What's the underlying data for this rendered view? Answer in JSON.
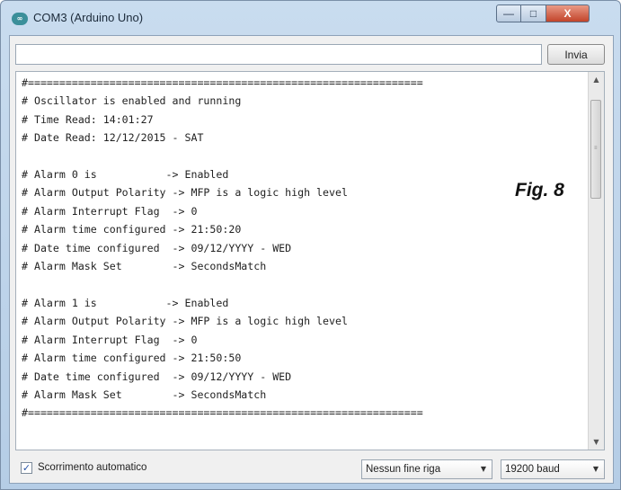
{
  "window": {
    "title": "COM3 (Arduino Uno)",
    "icon_text": "∞",
    "controls": {
      "minimize": "—",
      "maximize": "□",
      "close": "X"
    }
  },
  "send": {
    "input_value": "",
    "input_placeholder": "",
    "button_label": "Invia"
  },
  "serial_output": [
    "#===============================================================",
    "# Oscillator is enabled and running",
    "# Time Read: 14:01:27",
    "# Date Read: 12/12/2015 - SAT",
    "",
    "# Alarm 0 is           -> Enabled",
    "# Alarm Output Polarity -> MFP is a logic high level",
    "# Alarm Interrupt Flag  -> 0",
    "# Alarm time configured -> 21:50:20",
    "# Date time configured  -> 09/12/YYYY - WED",
    "# Alarm Mask Set        -> SecondsMatch",
    "",
    "# Alarm 1 is           -> Enabled",
    "# Alarm Output Polarity -> MFP is a logic high level",
    "# Alarm Interrupt Flag  -> 0",
    "# Alarm time configured -> 21:50:50",
    "# Date time configured  -> 09/12/YYYY - WED",
    "# Alarm Mask Set        -> SecondsMatch",
    "#==============================================================="
  ],
  "figure_label": "Fig. 8",
  "scrollbar": {
    "up_arrow": "▲",
    "down_arrow": "▼",
    "position": 0.05
  },
  "bottom": {
    "autoscroll_checked": true,
    "autoscroll_mark": "✓",
    "autoscroll_label": "Scorrimento automatico",
    "line_ending": "Nessun fine riga",
    "baud_rate": "19200 baud",
    "dropdown_arrow": "▼"
  }
}
